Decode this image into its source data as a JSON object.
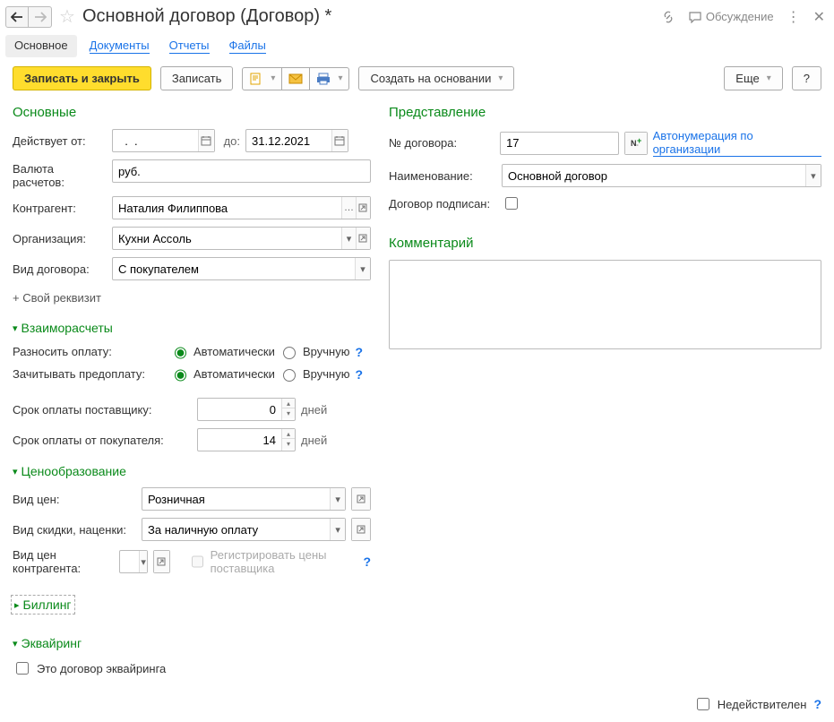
{
  "title": "Основной договор (Договор) *",
  "header": {
    "discuss": "Обсуждение"
  },
  "tabs": {
    "main": "Основное",
    "docs": "Документы",
    "reports": "Отчеты",
    "files": "Файлы"
  },
  "toolbar": {
    "write_close": "Записать и закрыть",
    "write": "Записать",
    "create_from": "Создать на основании",
    "more": "Еще",
    "help": "?"
  },
  "sections": {
    "main": "Основные",
    "presentation": "Представление",
    "comment": "Комментарий",
    "settlements": "Взаиморасчеты",
    "pricing": "Ценообразование",
    "billing": "Биллинг",
    "acquiring": "Эквайринг"
  },
  "left": {
    "valid_from_label": "Действует от:",
    "valid_from": "  .  .    ",
    "to_label": "до:",
    "valid_to": "31.12.2021",
    "currency_label": "Валюта расчетов:",
    "currency": "руб.",
    "counterparty_label": "Контрагент:",
    "counterparty": "Наталия Филиппова",
    "org_label": "Организация:",
    "org": "Кухни Ассоль",
    "contract_type_label": "Вид договора:",
    "contract_type": "С покупателем",
    "add_requisite": "+ Свой реквизит"
  },
  "right": {
    "number_label": "№ договора:",
    "number": "17",
    "autonum_link": "Автонумерация по организации",
    "name_label": "Наименование:",
    "name": "Основной договор",
    "signed_label": "Договор подписан:"
  },
  "settlements": {
    "split_label": "Разносить оплату:",
    "credit_label": "Зачитывать предоплату:",
    "auto": "Автоматически",
    "manual": "Вручную",
    "supplier_term_label": "Срок оплаты поставщику:",
    "supplier_term": "0",
    "buyer_term_label": "Срок оплаты от покупателя:",
    "buyer_term": "14",
    "days": "дней"
  },
  "pricing": {
    "price_type_label": "Вид цен:",
    "price_type": "Розничная",
    "discount_label": "Вид скидки, наценки:",
    "discount": "За наличную оплату",
    "counterparty_price_label": "Вид цен контрагента:",
    "register_supplier_prices": "Регистрировать цены поставщика"
  },
  "acquiring": {
    "is_acquiring": "Это договор эквайринга"
  },
  "footer": {
    "inactive": "Недействителен"
  }
}
